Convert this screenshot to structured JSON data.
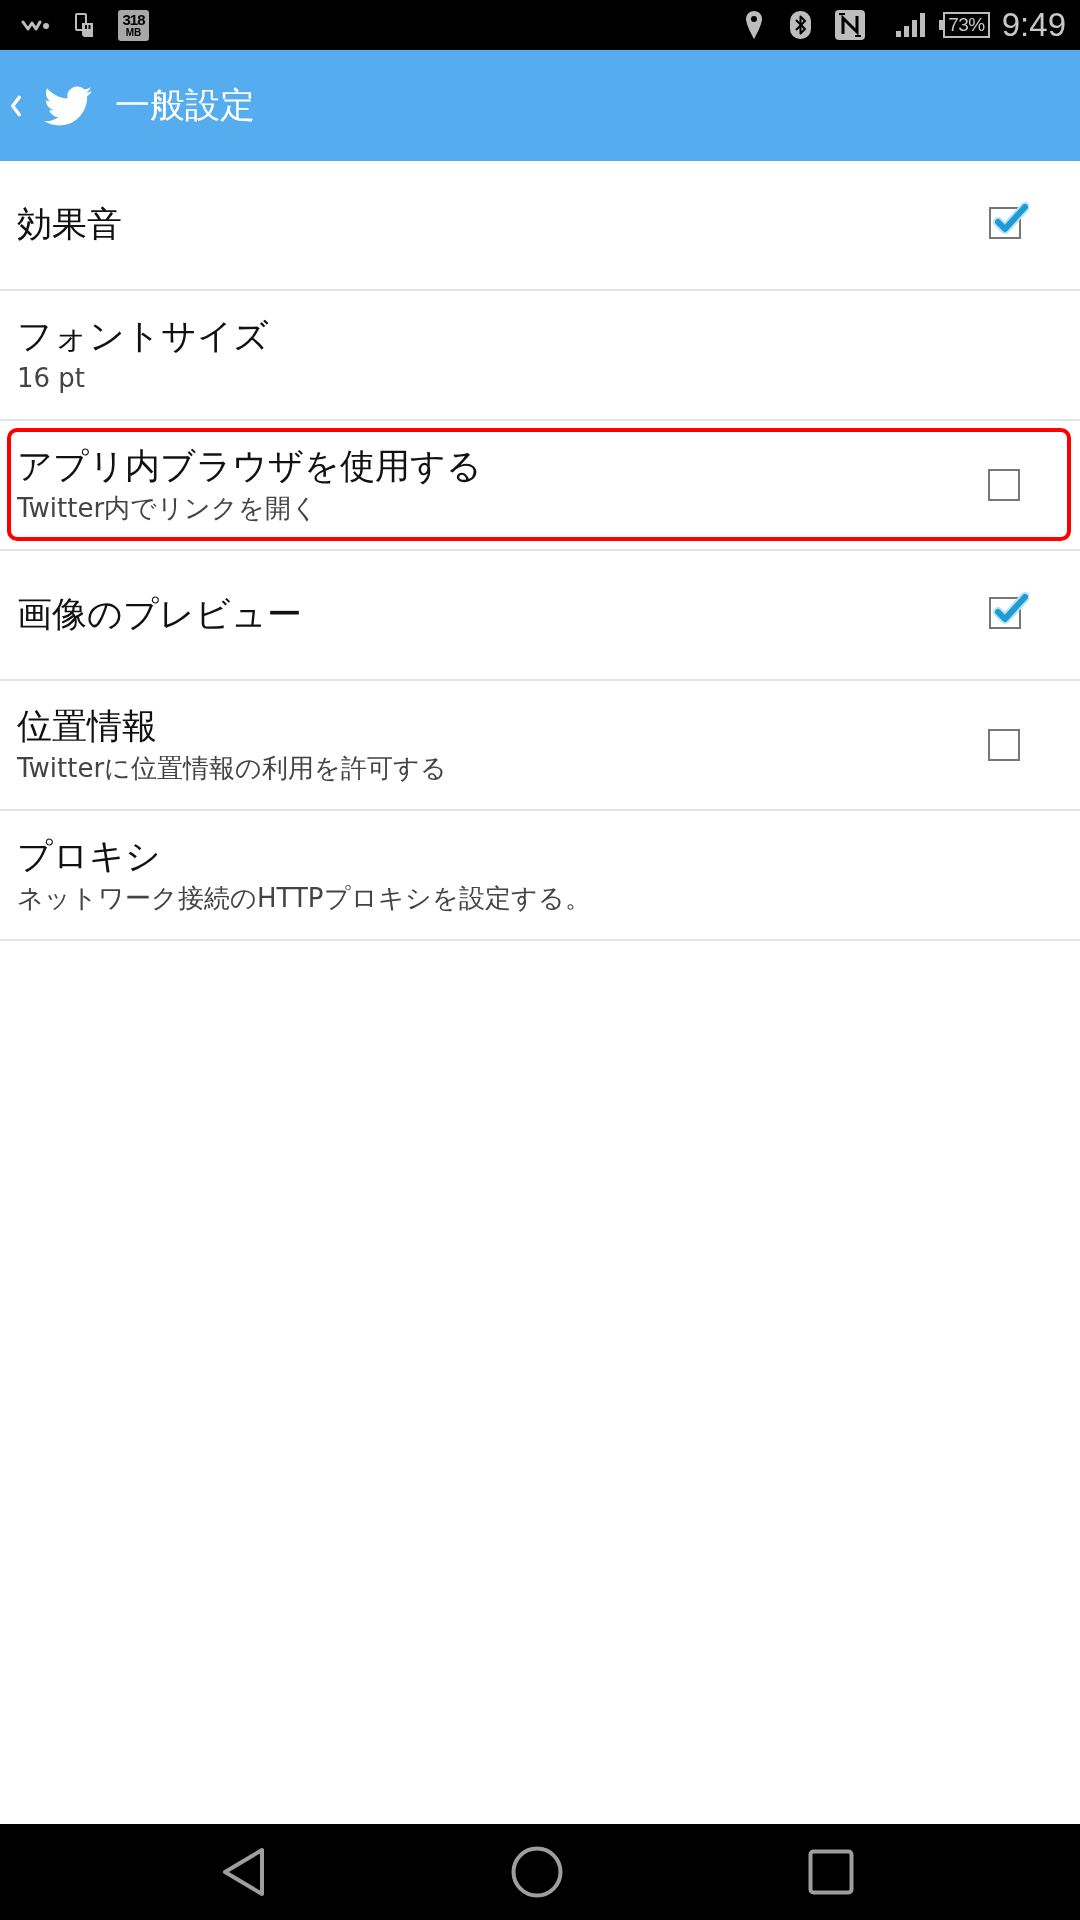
{
  "status_bar": {
    "storage_badge": {
      "number": "318",
      "unit": "MB"
    },
    "battery_text": "73%",
    "time": "9:49"
  },
  "header": {
    "title": "一般設定"
  },
  "settings": [
    {
      "kind": "checkbox",
      "title": "効果音",
      "checked": true,
      "highlighted": false
    },
    {
      "kind": "plain",
      "title": "フォントサイズ",
      "subtitle": "16 pt",
      "highlighted": false
    },
    {
      "kind": "checkbox",
      "title": "アプリ内ブラウザを使用する",
      "subtitle": "Twitter内でリンクを開く",
      "checked": false,
      "highlighted": true
    },
    {
      "kind": "checkbox",
      "title": "画像のプレビュー",
      "checked": true,
      "highlighted": false
    },
    {
      "kind": "checkbox",
      "title": "位置情報",
      "subtitle": "Twitterに位置情報の利用を許可する",
      "checked": false,
      "highlighted": false
    },
    {
      "kind": "plain",
      "title": "プロキシ",
      "subtitle": "ネットワーク接続のHTTPプロキシを設定する。",
      "highlighted": false
    }
  ]
}
